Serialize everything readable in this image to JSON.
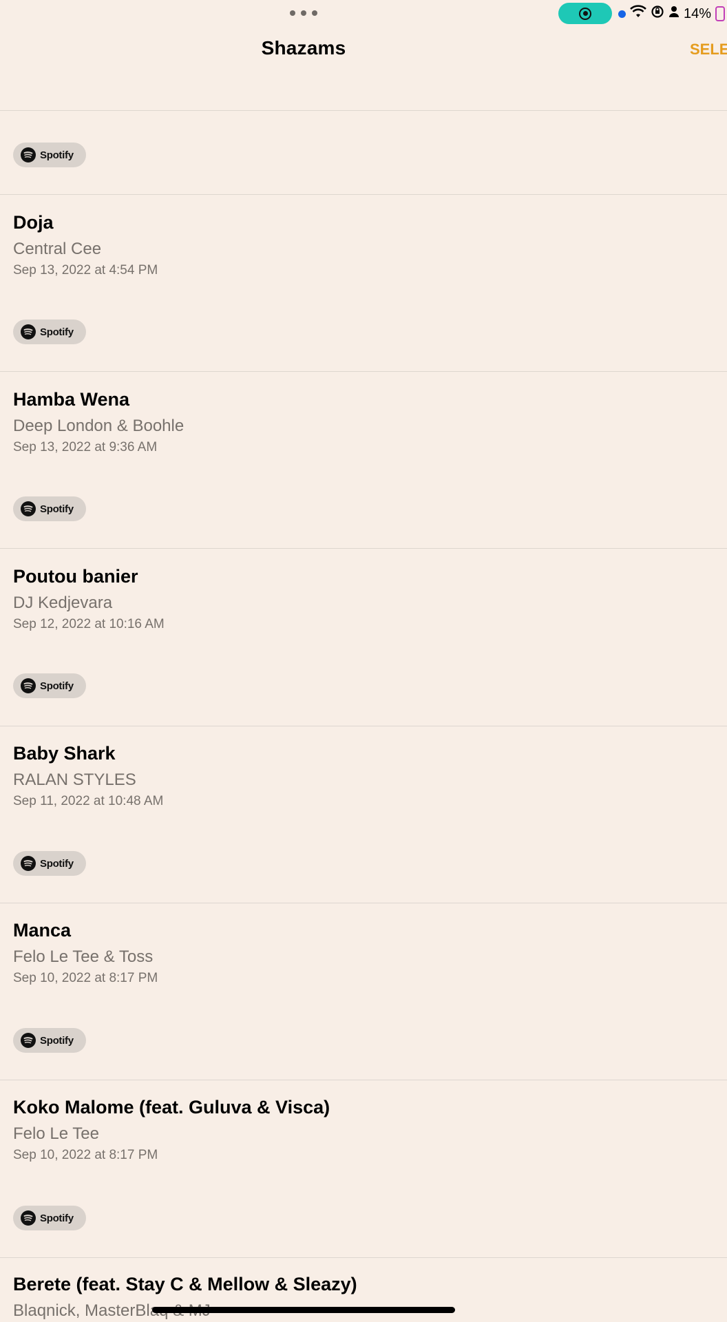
{
  "status_bar": {
    "battery_percent": "14%",
    "icons": [
      "more-dots-icon",
      "screen-record-icon",
      "blue-dot-icon",
      "wifi-icon",
      "orientation-lock-icon",
      "person-icon",
      "battery-icon"
    ]
  },
  "nav": {
    "title": "Shazams",
    "select_label": "SELE"
  },
  "spotify_label": "Spotify",
  "tracks": [
    {
      "title": "Doja",
      "artist": "Central Cee",
      "date": "Sep 13, 2022 at 4:54 PM"
    },
    {
      "title": "Hamba Wena",
      "artist": "Deep London & Boohle",
      "date": "Sep 13, 2022 at 9:36 AM"
    },
    {
      "title": "Poutou banier",
      "artist": "DJ Kedjevara",
      "date": "Sep 12, 2022 at 10:16 AM"
    },
    {
      "title": "Baby Shark",
      "artist": "RALAN STYLES",
      "date": "Sep 11, 2022 at 10:48 AM"
    },
    {
      "title": "Manca",
      "artist": "Felo Le Tee & Toss",
      "date": "Sep 10, 2022 at 8:17 PM"
    },
    {
      "title": "Koko Malome (feat. Guluva & Visca)",
      "artist": "Felo Le Tee",
      "date": "Sep 10, 2022 at 8:17 PM"
    },
    {
      "title": "Berete (feat. Stay C & Mellow & Sleazy)",
      "artist": "Blaqnick, MasterBlaq & MJ",
      "date": ""
    }
  ],
  "colors": {
    "background": "#f8eee6",
    "accent": "#e59c1e",
    "record_pill": "#1ec8b6"
  }
}
